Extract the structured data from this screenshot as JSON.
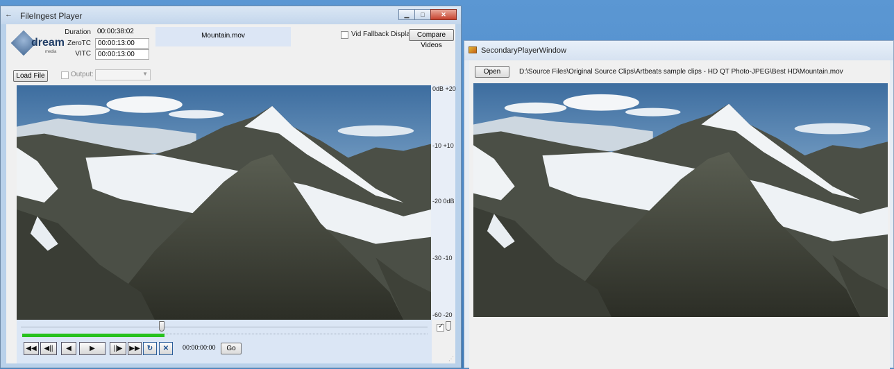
{
  "main_window": {
    "title": "FileIngest Player",
    "title_icon": "←",
    "logo": {
      "word": "dream",
      "sub": "media"
    },
    "fields": {
      "duration_label": "Duration",
      "duration_value": "00:00:38:02",
      "zerotc_label": "ZeroTC",
      "zerotc_value": "00:00:13:00",
      "vitc_label": "VITC",
      "vitc_value": "00:00:13:00"
    },
    "file_name": "Mountain.mov",
    "vid_fallback_label": "Vid Fallback Display",
    "compare_button": "Compare Videos",
    "load_button": "Load File",
    "output_label": "Output:",
    "meter_labels": [
      "0dB +20",
      "-10 +10",
      "-20 0dB",
      "-30 -10",
      "-60 -20"
    ],
    "transport": {
      "buttons": [
        "◀◀",
        "◀||",
        "◀",
        "▶",
        "||▶",
        "▶▶",
        "↻",
        "✕"
      ],
      "timecode": "00:00:00:00",
      "go_button": "Go"
    },
    "progress_fraction": 0.35
  },
  "secondary_window": {
    "title": "SecondaryPlayerWindow",
    "open_button": "Open",
    "file_path": "D:\\Source  Files\\Original Source Clips\\Artbeats sample clips - HD QT Photo-JPEG\\Best HD\\Mountain.mov"
  },
  "colors": {
    "progress": "#27c21e",
    "file_box": "#dce6f5",
    "desktop": "#4a86c4"
  }
}
